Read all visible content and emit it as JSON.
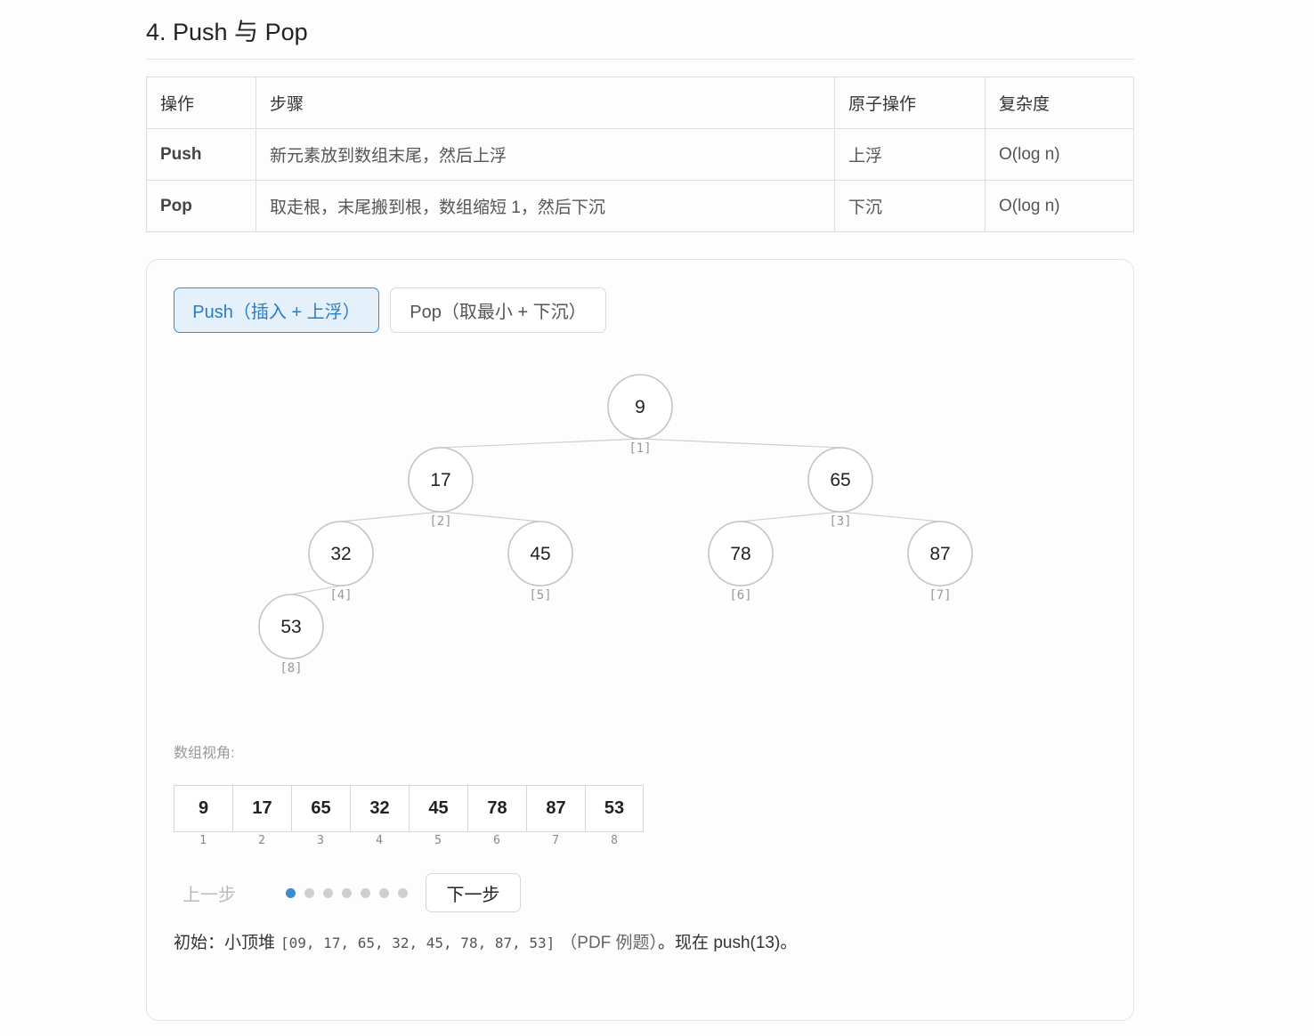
{
  "heading": "4. Push 与 Pop",
  "table": {
    "headers": [
      "操作",
      "步骤",
      "原子操作",
      "复杂度"
    ],
    "rows": [
      [
        "Push",
        "新元素放到数组末尾，然后上浮",
        "上浮",
        "O(log n)"
      ],
      [
        "Pop",
        "取走根，末尾搬到根，数组缩短 1，然后下沉",
        "下沉",
        "O(log n)"
      ]
    ]
  },
  "tabs": {
    "push": "Push（插入 + 上浮）",
    "pop": "Pop（取最小 + 下沉）",
    "active": "push"
  },
  "tree": {
    "nodes": [
      {
        "value": "9",
        "index": "[1]"
      },
      {
        "value": "17",
        "index": "[2]"
      },
      {
        "value": "65",
        "index": "[3]"
      },
      {
        "value": "32",
        "index": "[4]"
      },
      {
        "value": "45",
        "index": "[5]"
      },
      {
        "value": "78",
        "index": "[6]"
      },
      {
        "value": "87",
        "index": "[7]"
      },
      {
        "value": "53",
        "index": "[8]"
      }
    ]
  },
  "array": {
    "label": "数组视角:",
    "cells": [
      {
        "value": "9",
        "index": "1"
      },
      {
        "value": "17",
        "index": "2"
      },
      {
        "value": "65",
        "index": "3"
      },
      {
        "value": "32",
        "index": "4"
      },
      {
        "value": "45",
        "index": "5"
      },
      {
        "value": "78",
        "index": "6"
      },
      {
        "value": "87",
        "index": "7"
      },
      {
        "value": "53",
        "index": "8"
      }
    ]
  },
  "controls": {
    "prev": "上一步",
    "next": "下一步",
    "step_count": 7,
    "current_step": 1,
    "active_color": "#3c8bd0"
  },
  "caption": {
    "prefix": "初始：小顶堆",
    "code": "[09, 17, 65, 32, 45, 78, 87, 53]",
    "source": "（PDF 例题）",
    "suffix": "。现在 push(13)。"
  }
}
